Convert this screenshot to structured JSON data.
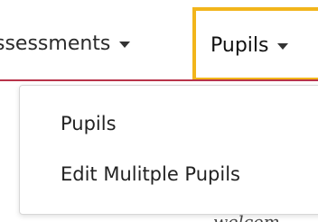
{
  "nav": {
    "items": [
      {
        "label": "ssessments"
      },
      {
        "label": "Pupils"
      }
    ]
  },
  "dropdown": {
    "items": [
      {
        "label": "Pupils"
      },
      {
        "label": "Edit Mulitple Pupils"
      }
    ]
  },
  "background": {
    "text": "welcom"
  },
  "colors": {
    "focus_outline": "#f2b51b",
    "nav_underline": "#b8334a",
    "menu_border": "#d7d7d7"
  }
}
